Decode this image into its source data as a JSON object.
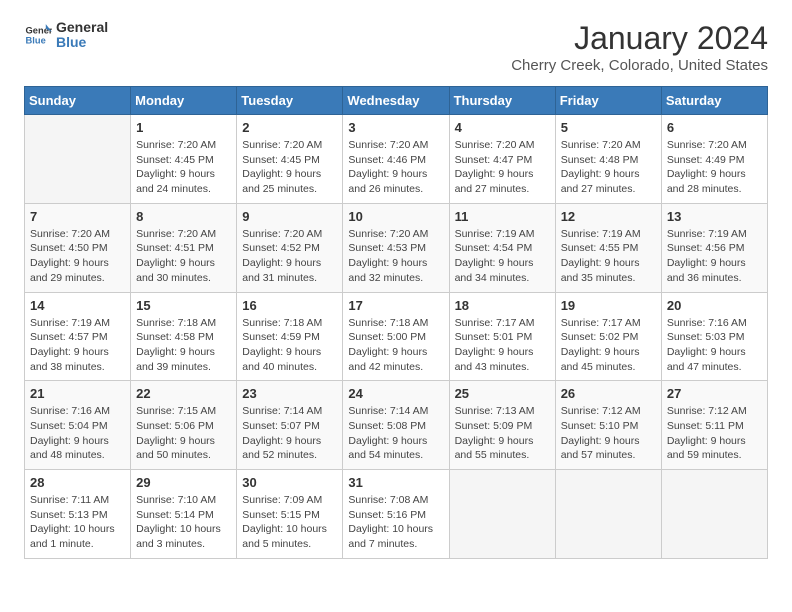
{
  "header": {
    "logo": {
      "general": "General",
      "blue": "Blue"
    },
    "title": "January 2024",
    "subtitle": "Cherry Creek, Colorado, United States"
  },
  "calendar": {
    "days_of_week": [
      "Sunday",
      "Monday",
      "Tuesday",
      "Wednesday",
      "Thursday",
      "Friday",
      "Saturday"
    ],
    "weeks": [
      [
        {
          "day": "",
          "info": ""
        },
        {
          "day": "1",
          "info": "Sunrise: 7:20 AM\nSunset: 4:45 PM\nDaylight: 9 hours\nand 24 minutes."
        },
        {
          "day": "2",
          "info": "Sunrise: 7:20 AM\nSunset: 4:45 PM\nDaylight: 9 hours\nand 25 minutes."
        },
        {
          "day": "3",
          "info": "Sunrise: 7:20 AM\nSunset: 4:46 PM\nDaylight: 9 hours\nand 26 minutes."
        },
        {
          "day": "4",
          "info": "Sunrise: 7:20 AM\nSunset: 4:47 PM\nDaylight: 9 hours\nand 27 minutes."
        },
        {
          "day": "5",
          "info": "Sunrise: 7:20 AM\nSunset: 4:48 PM\nDaylight: 9 hours\nand 27 minutes."
        },
        {
          "day": "6",
          "info": "Sunrise: 7:20 AM\nSunset: 4:49 PM\nDaylight: 9 hours\nand 28 minutes."
        }
      ],
      [
        {
          "day": "7",
          "info": "Sunrise: 7:20 AM\nSunset: 4:50 PM\nDaylight: 9 hours\nand 29 minutes."
        },
        {
          "day": "8",
          "info": "Sunrise: 7:20 AM\nSunset: 4:51 PM\nDaylight: 9 hours\nand 30 minutes."
        },
        {
          "day": "9",
          "info": "Sunrise: 7:20 AM\nSunset: 4:52 PM\nDaylight: 9 hours\nand 31 minutes."
        },
        {
          "day": "10",
          "info": "Sunrise: 7:20 AM\nSunset: 4:53 PM\nDaylight: 9 hours\nand 32 minutes."
        },
        {
          "day": "11",
          "info": "Sunrise: 7:19 AM\nSunset: 4:54 PM\nDaylight: 9 hours\nand 34 minutes."
        },
        {
          "day": "12",
          "info": "Sunrise: 7:19 AM\nSunset: 4:55 PM\nDaylight: 9 hours\nand 35 minutes."
        },
        {
          "day": "13",
          "info": "Sunrise: 7:19 AM\nSunset: 4:56 PM\nDaylight: 9 hours\nand 36 minutes."
        }
      ],
      [
        {
          "day": "14",
          "info": "Sunrise: 7:19 AM\nSunset: 4:57 PM\nDaylight: 9 hours\nand 38 minutes."
        },
        {
          "day": "15",
          "info": "Sunrise: 7:18 AM\nSunset: 4:58 PM\nDaylight: 9 hours\nand 39 minutes."
        },
        {
          "day": "16",
          "info": "Sunrise: 7:18 AM\nSunset: 4:59 PM\nDaylight: 9 hours\nand 40 minutes."
        },
        {
          "day": "17",
          "info": "Sunrise: 7:18 AM\nSunset: 5:00 PM\nDaylight: 9 hours\nand 42 minutes."
        },
        {
          "day": "18",
          "info": "Sunrise: 7:17 AM\nSunset: 5:01 PM\nDaylight: 9 hours\nand 43 minutes."
        },
        {
          "day": "19",
          "info": "Sunrise: 7:17 AM\nSunset: 5:02 PM\nDaylight: 9 hours\nand 45 minutes."
        },
        {
          "day": "20",
          "info": "Sunrise: 7:16 AM\nSunset: 5:03 PM\nDaylight: 9 hours\nand 47 minutes."
        }
      ],
      [
        {
          "day": "21",
          "info": "Sunrise: 7:16 AM\nSunset: 5:04 PM\nDaylight: 9 hours\nand 48 minutes."
        },
        {
          "day": "22",
          "info": "Sunrise: 7:15 AM\nSunset: 5:06 PM\nDaylight: 9 hours\nand 50 minutes."
        },
        {
          "day": "23",
          "info": "Sunrise: 7:14 AM\nSunset: 5:07 PM\nDaylight: 9 hours\nand 52 minutes."
        },
        {
          "day": "24",
          "info": "Sunrise: 7:14 AM\nSunset: 5:08 PM\nDaylight: 9 hours\nand 54 minutes."
        },
        {
          "day": "25",
          "info": "Sunrise: 7:13 AM\nSunset: 5:09 PM\nDaylight: 9 hours\nand 55 minutes."
        },
        {
          "day": "26",
          "info": "Sunrise: 7:12 AM\nSunset: 5:10 PM\nDaylight: 9 hours\nand 57 minutes."
        },
        {
          "day": "27",
          "info": "Sunrise: 7:12 AM\nSunset: 5:11 PM\nDaylight: 9 hours\nand 59 minutes."
        }
      ],
      [
        {
          "day": "28",
          "info": "Sunrise: 7:11 AM\nSunset: 5:13 PM\nDaylight: 10 hours\nand 1 minute."
        },
        {
          "day": "29",
          "info": "Sunrise: 7:10 AM\nSunset: 5:14 PM\nDaylight: 10 hours\nand 3 minutes."
        },
        {
          "day": "30",
          "info": "Sunrise: 7:09 AM\nSunset: 5:15 PM\nDaylight: 10 hours\nand 5 minutes."
        },
        {
          "day": "31",
          "info": "Sunrise: 7:08 AM\nSunset: 5:16 PM\nDaylight: 10 hours\nand 7 minutes."
        },
        {
          "day": "",
          "info": ""
        },
        {
          "day": "",
          "info": ""
        },
        {
          "day": "",
          "info": ""
        }
      ]
    ]
  }
}
